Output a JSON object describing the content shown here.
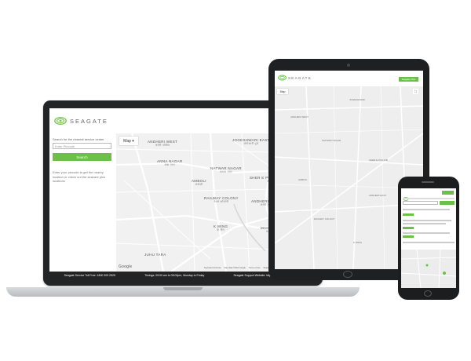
{
  "brand": {
    "name": "SEAGATE",
    "accent": "#6cc04a"
  },
  "header": {
    "plus_button": "Seagate Plus"
  },
  "sidebar": {
    "search_label": "Search for the nearest service center",
    "input_placeholder": "Enter Pincode",
    "search_button": "Search",
    "help_text": "Enter your pincode to get the nearby location or check out the seacare plus locations"
  },
  "map": {
    "type_button": "Map",
    "fullscreen_icon": "fullscreen-icon",
    "zoom_in": "+",
    "zoom_out": "−",
    "pegman_icon": "pegman-icon",
    "attribution_logo": "Google",
    "attribution": [
      "Keyboard shortcuts",
      "Map data ©2022 Google",
      "Terms of Use",
      "Report a map error"
    ],
    "areas": [
      {
        "name": "ANDHERI WEST",
        "sub": "अंधेरी पश्चिम"
      },
      {
        "name": "JOGESHWARI EAST",
        "sub": "जोगेश्वरी पूर्व"
      },
      {
        "name": "ANNA NAGAR",
        "sub": "अन्ना नगर"
      },
      {
        "name": "NATWAR NAGAR",
        "sub": "नटवर नगर"
      },
      {
        "name": "AMBOLI",
        "sub": "अंबोली"
      },
      {
        "name": "SHER E PUNJAB COLONY",
        "sub": "शेर ए पंजाब"
      },
      {
        "name": "RAILWAY COLONY",
        "sub": "रेलवे कॉलोनी"
      },
      {
        "name": "ANDHERI EAST",
        "sub": "अंधेरी पूर्व"
      },
      {
        "name": "Andheri",
        "sub": "अंधेरी"
      },
      {
        "name": "K WING",
        "sub": "के विंग"
      },
      {
        "name": "JUHU TARA",
        "sub": ""
      },
      {
        "name": "MAHANT",
        "sub": "महंत"
      }
    ]
  },
  "footer": {
    "toll_free": "Seagate Service Toll Free: 1800 309 2525",
    "timings": "Timings: 09:00 am to 05:00pm, Monday to Friday",
    "website": "Seagate Support Website: https://support2.seagate.com"
  }
}
